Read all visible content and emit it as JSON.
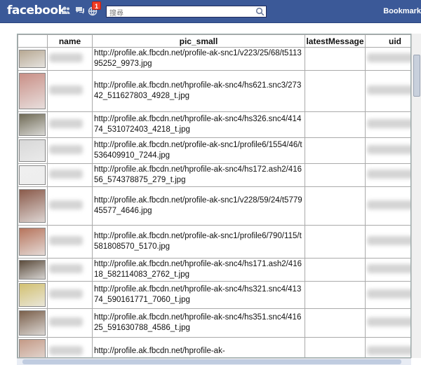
{
  "topbar": {
    "logo": "facebook",
    "notification_count": "1",
    "search_placeholder": "搜尋",
    "bookmark_label": "Bookmark",
    "colors": {
      "bar": "#3b5998",
      "badge": "#f03d25"
    }
  },
  "table": {
    "columns": [
      "name",
      "pic_small",
      "latestMessage",
      "uid"
    ],
    "rows": [
      {
        "pic_small": "http://profile.ak.fbcdn.net/profile-ak-snc1/v223/25/68/t511395252_9973.jpg"
      },
      {
        "pic_small": "http://profile.ak.fbcdn.net/hprofile-ak-snc4/hs621.snc3/27342_511627803_4928_t.jpg"
      },
      {
        "pic_small": "http://profile.ak.fbcdn.net/hprofile-ak-snc4/hs326.snc4/41474_531072403_4218_t.jpg"
      },
      {
        "pic_small": "http://profile.ak.fbcdn.net/profile-ak-snc1/profile6/1554/46/t536409910_7244.jpg"
      },
      {
        "pic_small": "http://profile.ak.fbcdn.net/hprofile-ak-snc4/hs172.ash2/41656_574378875_279_t.jpg"
      },
      {
        "pic_small": "http://profile.ak.fbcdn.net/profile-ak-snc1/v228/59/24/t577945577_4646.jpg"
      },
      {
        "pic_small": "http://profile.ak.fbcdn.net/profile-ak-snc1/profile6/790/115/t581808570_5170.jpg"
      },
      {
        "pic_small": "http://profile.ak.fbcdn.net/hprofile-ak-snc4/hs171.ash2/41618_582114083_2762_t.jpg"
      },
      {
        "pic_small": "http://profile.ak.fbcdn.net/hprofile-ak-snc4/hs321.snc4/41374_590161771_7060_t.jpg"
      },
      {
        "pic_small": "http://profile.ak.fbcdn.net/hprofile-ak-snc4/hs351.snc4/41625_591630788_4586_t.jpg"
      },
      {
        "pic_small": "http://profile.ak.fbcdn.net/hprofile-ak-"
      }
    ]
  }
}
